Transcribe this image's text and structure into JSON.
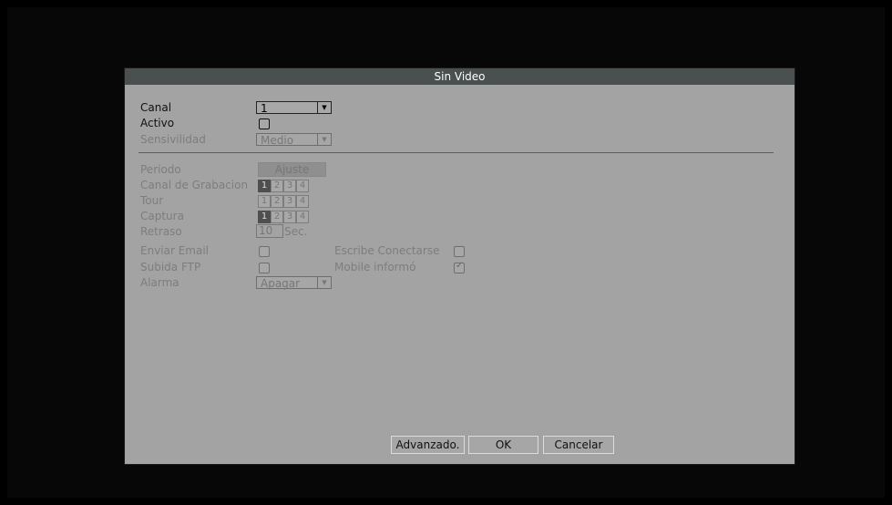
{
  "dialog": {
    "title": "Sin Video"
  },
  "fields": {
    "canal": {
      "label": "Canal",
      "value": "1"
    },
    "activo": {
      "label": "Activo"
    },
    "sensibilidad": {
      "label": "Sensivilidad",
      "value": "Medio"
    },
    "periodo": {
      "label": "Periodo",
      "button": "Ajuste"
    },
    "canal_grabacion": {
      "label": "Canal de Grabacion",
      "chips": [
        "1",
        "2",
        "3",
        "4"
      ],
      "selected": [
        "1"
      ]
    },
    "tour": {
      "label": "Tour",
      "chips": [
        "1",
        "2",
        "3",
        "4"
      ]
    },
    "captura": {
      "label": "Captura",
      "chips": [
        "1",
        "2",
        "3",
        "4"
      ],
      "selected": [
        "1"
      ]
    },
    "retraso": {
      "label": "Retraso",
      "value": "10",
      "unit": "Sec."
    },
    "enviar_email": {
      "label": "Enviar Email"
    },
    "subida_ftp": {
      "label": "Subida FTP"
    },
    "alarma": {
      "label": "Alarma",
      "value": "Apagar"
    },
    "escribe_conectarse": {
      "label": "Escribe Conectarse"
    },
    "mobile_informo": {
      "label": "Mobile informó",
      "checked": true
    }
  },
  "buttons": {
    "advanced": "Advanzado.",
    "ok": "OK",
    "cancel": "Cancelar"
  },
  "icons": {
    "dropdown_arrow": "▼",
    "check": "✓"
  }
}
